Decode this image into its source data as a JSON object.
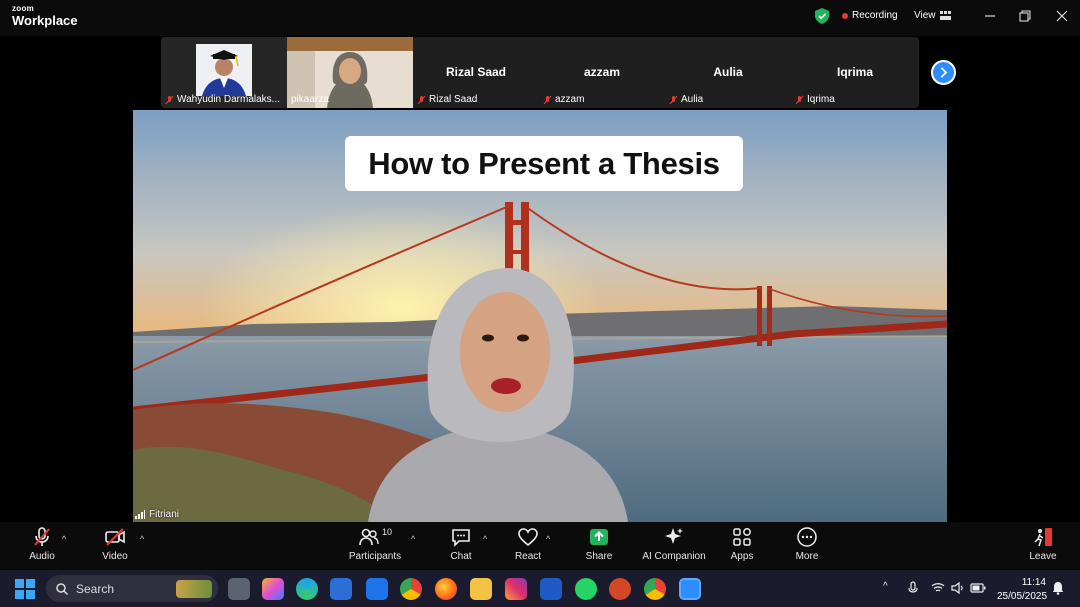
{
  "app": {
    "brand_top": "zoom",
    "brand_bottom": "Workplace"
  },
  "titlebar": {
    "recording_label": "Recording",
    "view_label": "View"
  },
  "participants_strip": [
    {
      "name": "Wahyudin Darmalaks...",
      "muted": true,
      "has_video": true
    },
    {
      "name": "pikaarza",
      "muted": false,
      "has_video": true
    },
    {
      "name": "Rizal Saad",
      "display": "Rizal Saad",
      "muted": true,
      "has_video": false
    },
    {
      "name": "azzam",
      "display": "azzam",
      "muted": true,
      "has_video": false
    },
    {
      "name": "Aulia",
      "display": "Aulia",
      "muted": true,
      "has_video": false
    },
    {
      "name": "Iqrima",
      "display": "Iqrima",
      "muted": true,
      "has_video": false
    }
  ],
  "main": {
    "slide_title": "How to Present a Thesis",
    "speaker_name": "Fitriani"
  },
  "toolbar": {
    "audio": "Audio",
    "video": "Video",
    "participants": "Participants",
    "participants_count": "10",
    "chat": "Chat",
    "react": "React",
    "share": "Share",
    "ai_companion": "AI Companion",
    "apps": "Apps",
    "more": "More",
    "leave": "Leave"
  },
  "taskbar": {
    "search_placeholder": "Search",
    "time": "11:14",
    "date": "25/05/2025"
  },
  "colors": {
    "accent_blue": "#2d8cff",
    "share_green": "#22b35e",
    "mute_red": "#e53935",
    "leave_red": "#e53935"
  }
}
